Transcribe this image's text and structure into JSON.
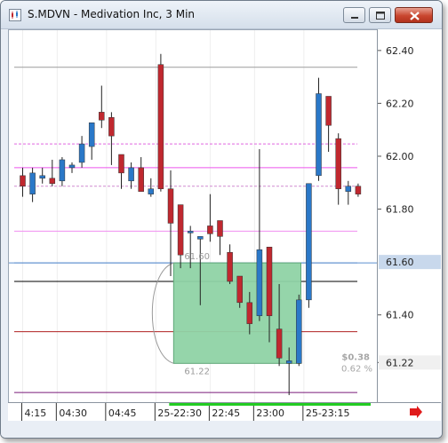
{
  "window": {
    "title": "S.MDVN - Medivation Inc, 3 Min",
    "buttons": [
      "minimize",
      "maximize",
      "close"
    ]
  },
  "colors": {
    "up": "#2a78c8",
    "down": "#c0282f",
    "range_fill": "#8fd3a5",
    "active_price_bg": "#c8d8ec"
  },
  "chart_data": {
    "type": "candlestick",
    "ylim": [
      61.07,
      62.48
    ],
    "y_ticks": [
      "62.40",
      "62.20",
      "62.00",
      "61.80",
      "61.40",
      "61.22"
    ],
    "y_tick_values": [
      62.4,
      62.2,
      62.0,
      61.8,
      61.4,
      61.22
    ],
    "x_ticks": [
      "4:15",
      "04:30",
      "04:45",
      "25-22:30",
      "22:45",
      "23:00",
      "25-23:15"
    ],
    "x_tick_indices": [
      0.5,
      4,
      9,
      14,
      19.5,
      24,
      29
    ],
    "active_price_label": "61.60",
    "active_price": 61.6,
    "candles": [
      {
        "o": 61.93,
        "h": 61.96,
        "l": 61.85,
        "c": 61.89
      },
      {
        "o": 61.86,
        "h": 61.96,
        "l": 61.83,
        "c": 61.94
      },
      {
        "o": 61.92,
        "h": 61.96,
        "l": 61.9,
        "c": 61.93
      },
      {
        "o": 61.92,
        "h": 61.99,
        "l": 61.89,
        "c": 61.9
      },
      {
        "o": 61.91,
        "h": 62.0,
        "l": 61.89,
        "c": 61.99
      },
      {
        "o": 61.96,
        "h": 61.98,
        "l": 61.94,
        "c": 61.97
      },
      {
        "o": 61.98,
        "h": 62.08,
        "l": 61.96,
        "c": 62.05
      },
      {
        "o": 62.04,
        "h": 62.12,
        "l": 61.99,
        "c": 62.13
      },
      {
        "o": 62.17,
        "h": 62.27,
        "l": 62.11,
        "c": 62.14
      },
      {
        "o": 62.15,
        "h": 62.17,
        "l": 61.97,
        "c": 62.08
      },
      {
        "o": 62.01,
        "h": 62.01,
        "l": 61.88,
        "c": 61.94
      },
      {
        "o": 61.91,
        "h": 61.98,
        "l": 61.88,
        "c": 61.96
      },
      {
        "o": 61.96,
        "h": 62.0,
        "l": 61.87,
        "c": 61.87
      },
      {
        "o": 61.86,
        "h": 61.92,
        "l": 61.85,
        "c": 61.88
      },
      {
        "o": 62.35,
        "h": 62.39,
        "l": 61.87,
        "c": 61.88
      },
      {
        "o": 61.88,
        "h": 61.95,
        "l": 61.55,
        "c": 61.75
      },
      {
        "o": 61.82,
        "h": 61.82,
        "l": 61.58,
        "c": 61.63
      },
      {
        "o": 61.72,
        "h": 61.74,
        "l": 61.58,
        "c": 61.72
      },
      {
        "o": 61.69,
        "h": 61.7,
        "l": 61.44,
        "c": 61.7
      },
      {
        "o": 61.74,
        "h": 61.86,
        "l": 61.68,
        "c": 61.71
      },
      {
        "o": 61.76,
        "h": 61.76,
        "l": 61.63,
        "c": 61.7
      },
      {
        "o": 61.64,
        "h": 61.67,
        "l": 61.52,
        "c": 61.53
      },
      {
        "o": 61.55,
        "h": 61.55,
        "l": 61.43,
        "c": 61.45
      },
      {
        "o": 61.45,
        "h": 61.49,
        "l": 61.33,
        "c": 61.37
      },
      {
        "o": 61.4,
        "h": 62.03,
        "l": 61.38,
        "c": 61.65
      },
      {
        "o": 61.66,
        "h": 61.66,
        "l": 61.3,
        "c": 61.4
      },
      {
        "o": 61.35,
        "h": 61.52,
        "l": 61.21,
        "c": 61.24
      },
      {
        "o": 61.22,
        "h": 61.28,
        "l": 61.1,
        "c": 61.23
      },
      {
        "o": 61.22,
        "h": 61.48,
        "l": 61.21,
        "c": 61.46
      },
      {
        "o": 61.46,
        "h": 61.9,
        "l": 61.43,
        "c": 61.9
      },
      {
        "o": 61.93,
        "h": 62.3,
        "l": 61.91,
        "c": 62.24
      },
      {
        "o": 62.23,
        "h": 62.2,
        "l": 62.02,
        "c": 62.12
      },
      {
        "o": 62.07,
        "h": 62.09,
        "l": 61.82,
        "c": 61.88
      },
      {
        "o": 61.87,
        "h": 61.91,
        "l": 61.82,
        "c": 61.89
      },
      {
        "o": 61.89,
        "h": 61.9,
        "l": 61.85,
        "c": 61.86
      }
    ],
    "hlines": [
      {
        "value": 62.34,
        "color": "#9c9c9c",
        "dash": ""
      },
      {
        "value": 62.05,
        "color": "#e066e0",
        "dash": "3,2"
      },
      {
        "value": 61.96,
        "color": "#ee55ee",
        "dash": ""
      },
      {
        "value": 61.89,
        "color": "#d08ad0",
        "dash": "3,2"
      },
      {
        "value": 61.72,
        "color": "#f08ef0",
        "dash": ""
      },
      {
        "value": 61.6,
        "color": "#5b8fcf",
        "dash": ""
      },
      {
        "value": 61.53,
        "color": "#000000",
        "dash": ""
      },
      {
        "value": 61.34,
        "color": "#b02020",
        "dash": ""
      },
      {
        "value": 61.11,
        "color": "#7a1a7a",
        "dash": ""
      }
    ],
    "range_box": {
      "high_label": "61.60",
      "low_label": "61.22",
      "change_label": "$0.38",
      "pct_label": "0.62 %",
      "high": 61.6,
      "low": 61.22,
      "start_index": 15.3,
      "end_index": 28.2
    }
  }
}
